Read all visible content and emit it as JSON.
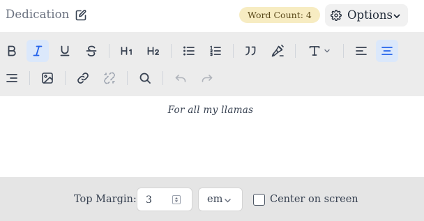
{
  "header": {
    "title": "Dedication",
    "word_count_badge": "Word Count: 4",
    "options_label": "Options"
  },
  "toolbar": {
    "buttons": [
      {
        "name": "bold",
        "icon": "bold-icon",
        "active": false
      },
      {
        "name": "italic",
        "icon": "italic-icon",
        "active": true
      },
      {
        "name": "underline",
        "icon": "underline-icon",
        "active": false
      },
      {
        "name": "strikethrough",
        "icon": "strikethrough-icon",
        "active": false
      },
      {
        "name": "heading-1",
        "icon": "heading-1-icon",
        "active": false
      },
      {
        "name": "heading-2",
        "icon": "heading-2-icon",
        "active": false
      },
      {
        "name": "bullet-list",
        "icon": "bullet-list-icon",
        "active": false
      },
      {
        "name": "ordered-list",
        "icon": "ordered-list-icon",
        "active": false
      },
      {
        "name": "blockquote",
        "icon": "quote-icon",
        "active": false
      },
      {
        "name": "signature",
        "icon": "fountain-pen-icon",
        "active": false
      },
      {
        "name": "text-style",
        "icon": "text-style-icon",
        "active": false
      },
      {
        "name": "align-left",
        "icon": "align-left-icon",
        "active": false
      },
      {
        "name": "align-center",
        "icon": "align-center-icon",
        "active": true
      },
      {
        "name": "align-right",
        "icon": "align-right-icon",
        "active": false
      },
      {
        "name": "image",
        "icon": "image-icon",
        "active": false
      },
      {
        "name": "link",
        "icon": "link-icon",
        "active": false
      },
      {
        "name": "unlink",
        "icon": "unlink-icon",
        "active": false
      },
      {
        "name": "search",
        "icon": "search-icon",
        "active": false
      },
      {
        "name": "undo",
        "icon": "undo-icon",
        "disabled": true
      },
      {
        "name": "redo",
        "icon": "redo-icon",
        "disabled": true
      }
    ],
    "accent_color": "#2563eb",
    "active_bg": "#dbe8fb"
  },
  "editor": {
    "content": "For all my llamas"
  },
  "footer": {
    "top_margin_label": "Top Margin:",
    "top_margin_value": "3",
    "unit_value": "em",
    "center_label": "Center on screen",
    "center_checked": false
  }
}
